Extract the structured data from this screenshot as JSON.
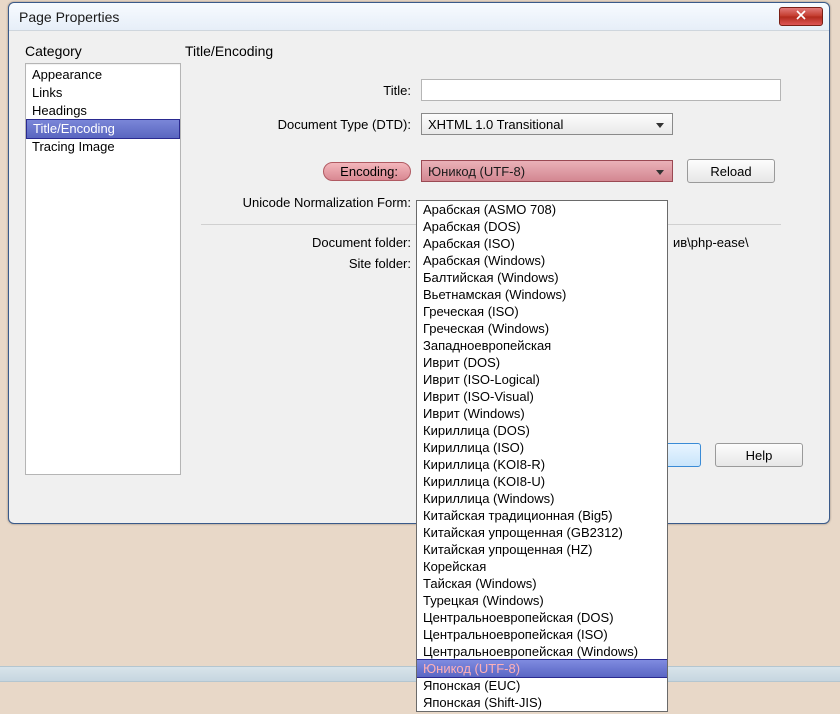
{
  "window": {
    "title": "Page Properties"
  },
  "headings": {
    "category": "Category",
    "section": "Title/Encoding"
  },
  "categories": {
    "items": [
      {
        "label": "Appearance"
      },
      {
        "label": "Links"
      },
      {
        "label": "Headings"
      },
      {
        "label": "Title/Encoding"
      },
      {
        "label": "Tracing Image"
      }
    ]
  },
  "labels": {
    "title": "Title:",
    "dtd": "Document Type (DTD):",
    "encoding": "Encoding:",
    "unf": "Unicode Normalization Form:",
    "doc_folder": "Document folder:",
    "site_folder": "Site folder:"
  },
  "values": {
    "dtd_selected": "XHTML 1.0 Transitional",
    "encoding_selected": "Юникод (UTF-8)",
    "doc_folder": "ив\\php-ease\\",
    "site_folder": ""
  },
  "buttons": {
    "reload": "Reload",
    "help": "Help"
  },
  "encoding_options": [
    "Арабская (ASMO 708)",
    "Арабская (DOS)",
    "Арабская (ISO)",
    "Арабская (Windows)",
    "Балтийская (Windows)",
    "Вьетнамская (Windows)",
    "Греческая (ISO)",
    "Греческая (Windows)",
    "Западноевропейская",
    "Иврит (DOS)",
    "Иврит (ISO-Logical)",
    "Иврит (ISO-Visual)",
    "Иврит (Windows)",
    "Кириллица (DOS)",
    "Кириллица (ISO)",
    "Кириллица (KOI8-R)",
    "Кириллица (KOI8-U)",
    "Кириллица (Windows)",
    "Китайская традиционная (Big5)",
    "Китайская упрощенная (GB2312)",
    "Китайская упрощенная (HZ)",
    "Корейская",
    "Тайская (Windows)",
    "Турецкая (Windows)",
    "Центральноевропейская (DOS)",
    "Центральноевропейская (ISO)",
    "Центральноевропейская (Windows)",
    "Юникод (UTF-8)",
    "Японская (EUC)",
    "Японская (Shift-JIS)"
  ],
  "encoding_selected_index": 27
}
